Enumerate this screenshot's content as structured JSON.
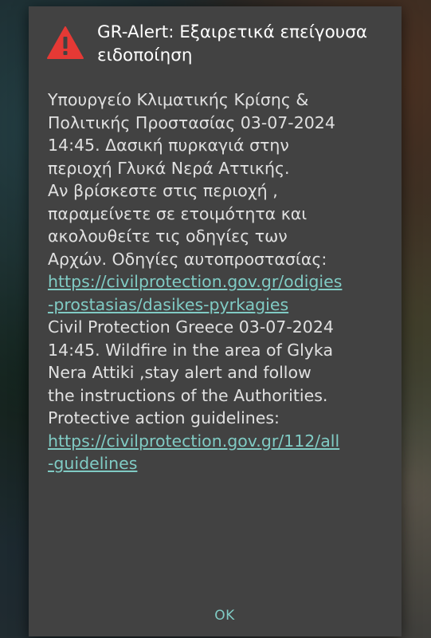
{
  "dialog": {
    "title": "GR-Alert: Εξαιρετικά επείγουσα ειδοποίηση",
    "icon": "warning-icon",
    "accent_color": "#80cbc4",
    "warning_color": "#e53935",
    "message": {
      "lines": [
        "Υπουργείο Κλιματικής Κρίσης &",
        "Πολιτικής Προστασίας 03-07-2024",
        "14:45. Δασική πυρκαγιά στην",
        "περιοχή Γλυκά Νερά Αττικής.",
        "Αν βρίσκεστε στις περιοχή ,",
        "παραμείνετε σε ετοιμότητα και",
        "ακολουθείτε τις οδηγίες των",
        "Αρχών. Οδηγίες αυτοπροστασίας:"
      ],
      "link1_line1": "https://civilprotection.gov.gr/odigies",
      "link1_line2": "-prostasias/dasikes-pyrkagies",
      "lines2": [
        "Civil Protection Greece 03-07-2024",
        "14:45. Wildfire in the area of Glyka",
        "Nera Attiki ,stay alert and follow",
        "the instructions of the Authorities.",
        "Protective action guidelines:"
      ],
      "link2_line1": "https://civilprotection.gov.gr/112/all",
      "link2_line2": "-guidelines"
    },
    "ok_label": "OK"
  }
}
